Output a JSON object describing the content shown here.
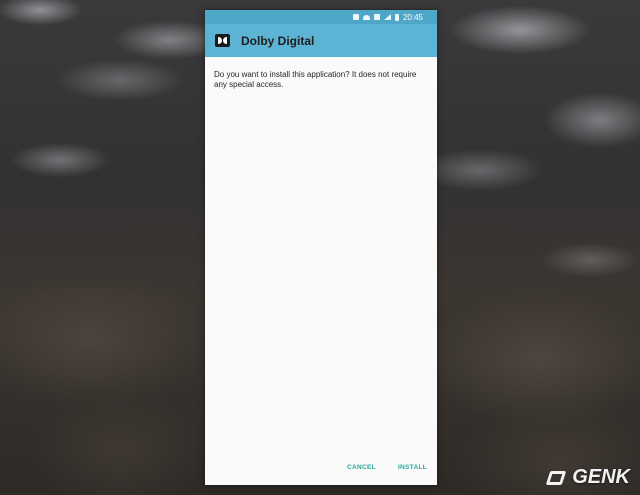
{
  "status_bar": {
    "time": "20:45",
    "icons": [
      "alarm-icon",
      "wifi-icon",
      "data-icon",
      "signal-icon",
      "battery-icon"
    ]
  },
  "toolbar": {
    "app_icon": "dolby-icon",
    "title": "Dolby Digital"
  },
  "dialog": {
    "message": "Do you want to install this application? It does not require any special access.",
    "cancel_label": "CANCEL",
    "install_label": "INSTALL"
  },
  "watermark": {
    "text": "GENK"
  },
  "colors": {
    "statusbar": "#4fa7c8",
    "toolbar": "#5cb3d3",
    "accent": "#2aa79b",
    "background": "#fafafa"
  }
}
